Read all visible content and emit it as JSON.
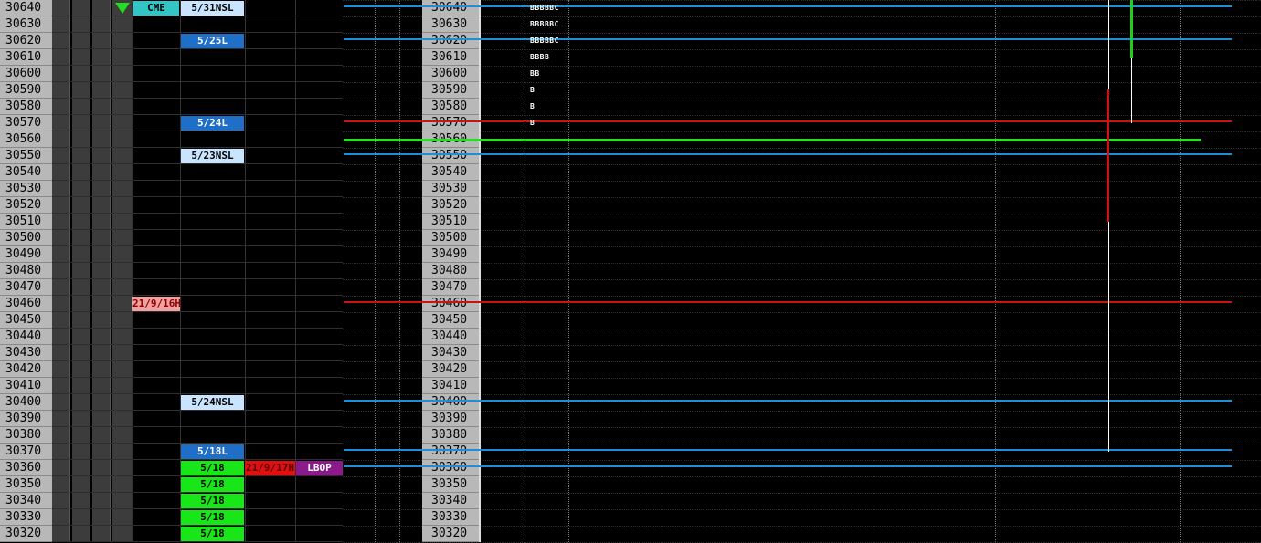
{
  "price_ladder": [
    30640,
    30630,
    30620,
    30610,
    30600,
    30590,
    30580,
    30570,
    30560,
    30550,
    30540,
    30530,
    30520,
    30510,
    30500,
    30490,
    30480,
    30470,
    30460,
    30450,
    30440,
    30430,
    30420,
    30410,
    30400,
    30390,
    30380,
    30370,
    30360,
    30350,
    30340,
    30330,
    30320
  ],
  "header": {
    "source_label": "CME",
    "indicator": "triangle-down-icon"
  },
  "markers": [
    {
      "row": 0,
      "text": "5/31NSL",
      "bg": "#c8e4ff",
      "fg": "#000"
    },
    {
      "row": 2,
      "text": "5/25L",
      "bg": "#1f6fc9",
      "fg": "#fff"
    },
    {
      "row": 7,
      "text": "5/24L",
      "bg": "#1f6fc9",
      "fg": "#fff"
    },
    {
      "row": 9,
      "text": "5/23NSL",
      "bg": "#c8e4ff",
      "fg": "#000"
    },
    {
      "row": 24,
      "text": "5/24NSL",
      "bg": "#c8e4ff",
      "fg": "#000"
    },
    {
      "row": 27,
      "text": "5/18L",
      "bg": "#1f6fc9",
      "fg": "#fff"
    },
    {
      "row": 28,
      "text": "5/18",
      "bg": "#19e619",
      "fg": "#000"
    },
    {
      "row": 29,
      "text": "5/18",
      "bg": "#19e619",
      "fg": "#000"
    },
    {
      "row": 30,
      "text": "5/18",
      "bg": "#19e619",
      "fg": "#000"
    },
    {
      "row": 31,
      "text": "5/18",
      "bg": "#19e619",
      "fg": "#000"
    },
    {
      "row": 32,
      "text": "5/18",
      "bg": "#19e619",
      "fg": "#000"
    }
  ],
  "side_markers": [
    {
      "row": 18,
      "col": "c",
      "text": "21/9/16H",
      "bg": "#f2a0a0",
      "fg": "#8b0000"
    },
    {
      "row": 28,
      "col": "e",
      "text": "21/9/17H",
      "bg": "#e01010",
      "fg": "#5a0000"
    },
    {
      "row": 28,
      "col": "f",
      "text": "LBOP",
      "bg": "#8b1a8b",
      "fg": "#fff"
    }
  ],
  "tpo_letters": [
    {
      "row": 0,
      "text": "BBBBBC"
    },
    {
      "row": 1,
      "text": "BBBBBC"
    },
    {
      "row": 2,
      "text": "BBBBBC"
    },
    {
      "row": 3,
      "text": "BBBB"
    },
    {
      "row": 4,
      "text": "BB"
    },
    {
      "row": 5,
      "text": "B"
    },
    {
      "row": 6,
      "text": "B"
    },
    {
      "row": 7,
      "text": "B"
    }
  ],
  "level_lines": [
    {
      "row": 0,
      "color": "#1e8fd6"
    },
    {
      "row": 2,
      "color": "#1e8fd6"
    },
    {
      "row": 7,
      "color": "#c81414"
    },
    {
      "row": 8,
      "color": "#22e022"
    },
    {
      "row": 9,
      "color": "#1e8fd6"
    },
    {
      "row": 18,
      "color": "#c81414"
    },
    {
      "row": 24,
      "color": "#1e8fd6"
    },
    {
      "row": 27,
      "color": "#1e8fd6"
    },
    {
      "row": 28,
      "color": "#1e8fd6"
    }
  ],
  "colors": {
    "grid": "#3a3a3a",
    "price_bg": "#b8b8b8",
    "dark_col": "#3c3c3c",
    "header_cyan": "#33c5c5"
  }
}
